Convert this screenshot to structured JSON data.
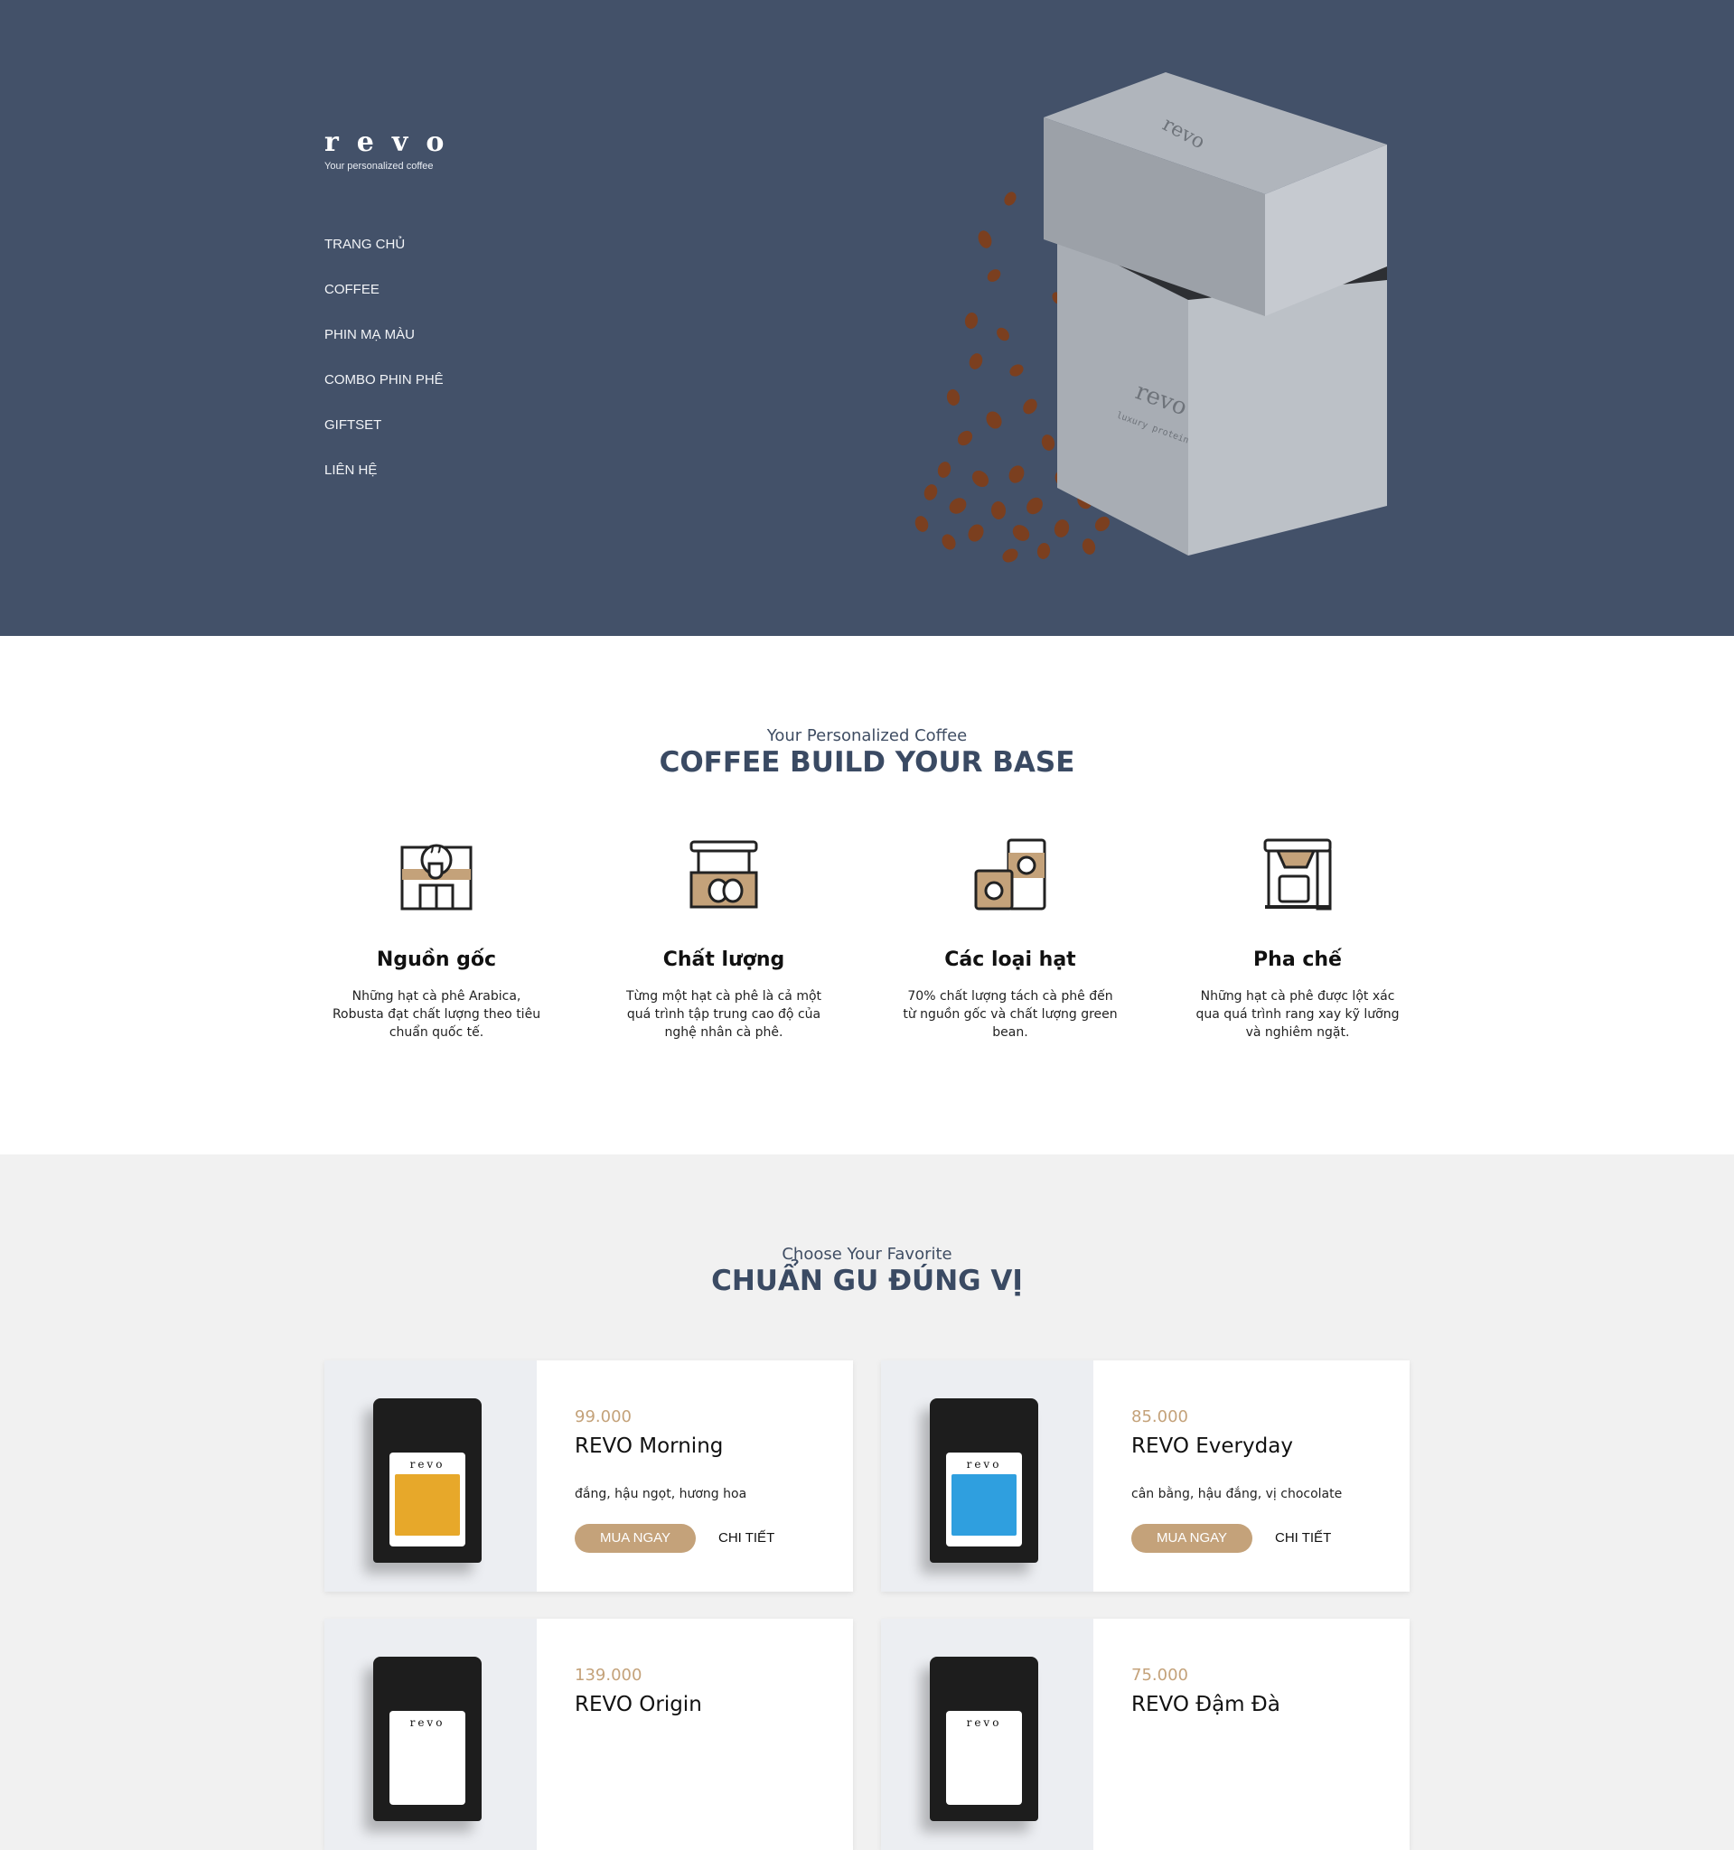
{
  "header": {
    "logo": "revo",
    "tagline": "Your personalized coffee",
    "nav": [
      "TRANG CHỦ",
      "COFFEE",
      "PHIN MẠ MÀU",
      "COMBO PHIN PHÊ",
      "GIFTSET",
      "LIÊN HỆ"
    ]
  },
  "hero": {
    "product_lid_text": "revo",
    "product_box_text": "revo",
    "product_box_subtext": "luxury protein"
  },
  "intro": {
    "subtitle": "Your Personalized Coffee",
    "title": "COFFEE BUILD YOUR BASE",
    "features": [
      {
        "icon": "coffee-shop-icon",
        "title": "Nguồn gốc",
        "text": "Những hạt cà phê Arabica, Robusta đạt chất lượng theo tiêu chuẩn quốc tế."
      },
      {
        "icon": "coffee-bag-icon",
        "title": "Chất lượng",
        "text": "Từng một hạt cà phê là cả một quá trình tập trung cao độ của nghệ nhân cà phê."
      },
      {
        "icon": "coffee-jars-icon",
        "title": "Các loại hạt",
        "text": "70% chất lượng tách cà phê đến từ nguồn gốc và chất lượng green bean."
      },
      {
        "icon": "coffee-machine-icon",
        "title": "Pha chế",
        "text": "Những hạt cà phê được lột xác qua quá trình rang xay kỹ lưỡng và nghiêm ngặt."
      }
    ]
  },
  "products": {
    "subtitle": "Choose Your Favorite",
    "title": "CHUẨN GU ĐÚNG VỊ",
    "buy_label": "MUA NGAY",
    "detail_label": "CHI TIẾT",
    "bag_brand": "revo",
    "items": [
      {
        "price": "99.000",
        "name": "REVO Morning",
        "desc": "đắng, hậu ngọt, hương hoa",
        "label_color": "#e7a82a"
      },
      {
        "price": "85.000",
        "name": "REVO Everyday",
        "desc": "cân bằng, hậu đắng, vị chocolate",
        "label_color": "#2f9fdf"
      },
      {
        "price": "139.000",
        "name": "REVO Origin",
        "desc": "",
        "label_color": "#ffffff"
      },
      {
        "price": "75.000",
        "name": "REVO Đậm Đà",
        "desc": "",
        "label_color": "#ffffff"
      }
    ]
  },
  "colors": {
    "hero_bg": "#435169",
    "accent": "#c4a27a",
    "heading": "#3a4a63"
  }
}
